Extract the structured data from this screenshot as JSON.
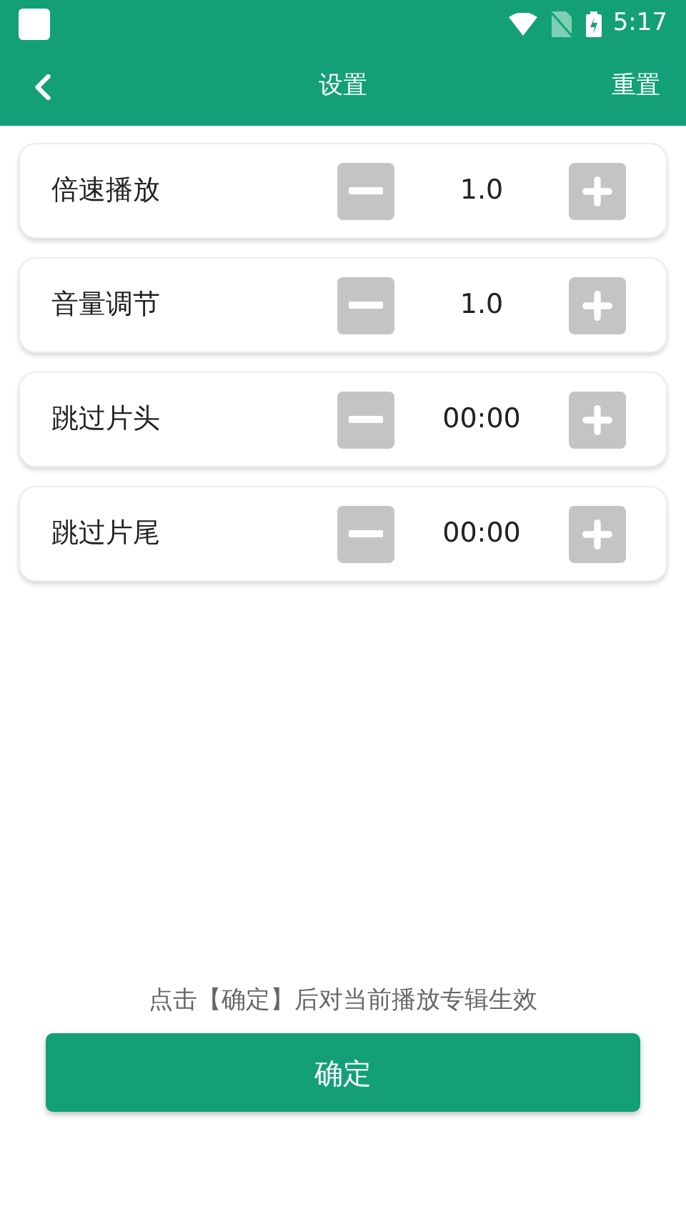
{
  "status_bar": {
    "time": "5:17"
  },
  "toolbar": {
    "title": "设置",
    "action": "重置"
  },
  "settings": [
    {
      "label": "倍速播放",
      "value": "1.0"
    },
    {
      "label": "音量调节",
      "value": "1.0"
    },
    {
      "label": "跳过片头",
      "value": "00:00"
    },
    {
      "label": "跳过片尾",
      "value": "00:00"
    }
  ],
  "note": "点击【确定】后对当前播放专辑生效",
  "confirm_button": "确定"
}
